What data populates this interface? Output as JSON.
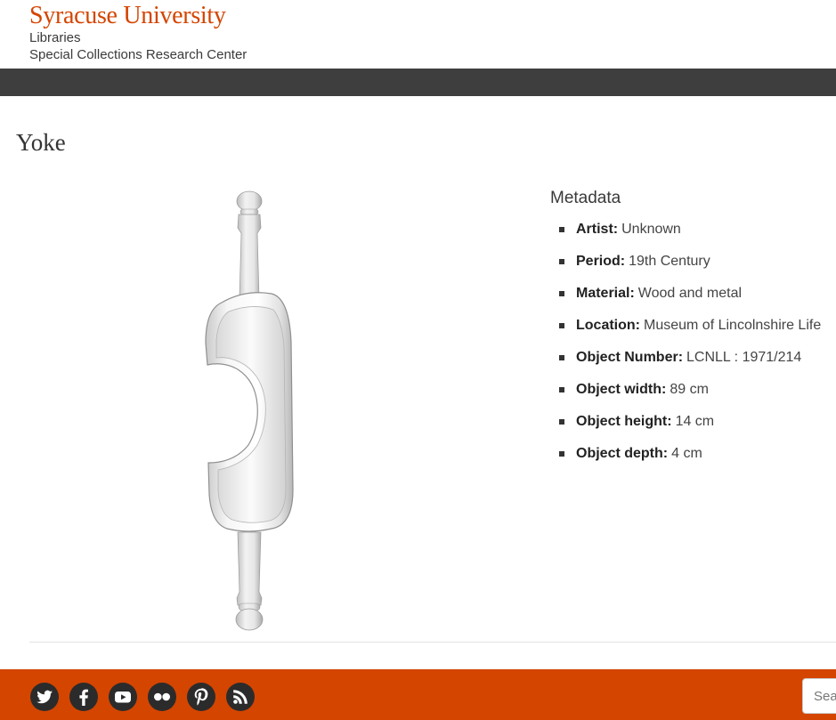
{
  "header": {
    "university": "Syracuse University",
    "unit": "Libraries",
    "department": "Special Collections Research Center"
  },
  "page": {
    "title": "Yoke"
  },
  "metadata": {
    "heading": "Metadata",
    "items": [
      {
        "label": "Artist:",
        "value": "Unknown"
      },
      {
        "label": "Period:",
        "value": "19th Century"
      },
      {
        "label": "Material:",
        "value": "Wood and metal"
      },
      {
        "label": "Location:",
        "value": "Museum of Lincolnshire Life"
      },
      {
        "label": "Object Number:",
        "value": "LCNLL : 1971/214"
      },
      {
        "label": "Object width:",
        "value": "89 cm"
      },
      {
        "label": "Object height:",
        "value": "14 cm"
      },
      {
        "label": "Object depth:",
        "value": "4 cm"
      }
    ]
  },
  "footer": {
    "social_icons": [
      "twitter-icon",
      "facebook-icon",
      "youtube-icon",
      "flickr-icon",
      "pinterest-icon",
      "rss-icon"
    ],
    "search_placeholder": "Search"
  },
  "colors": {
    "brand": "#d44500",
    "navbar": "#3e3e3e",
    "text": "#333333"
  }
}
